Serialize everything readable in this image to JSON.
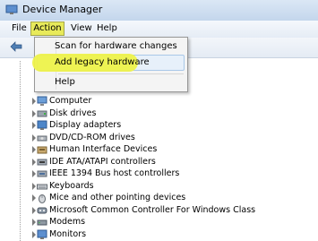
{
  "window": {
    "title": "Device Manager"
  },
  "menubar": {
    "file": "File",
    "action": "Action",
    "view": "View",
    "help": "Help"
  },
  "dropdown": {
    "items": [
      "Scan for hardware changes",
      "Add legacy hardware",
      "Help"
    ],
    "highlight_color": "#eef24a"
  },
  "tree": {
    "items": [
      {
        "label": "Computer",
        "icon": "computer-icon"
      },
      {
        "label": "Disk drives",
        "icon": "disk-icon"
      },
      {
        "label": "Display adapters",
        "icon": "display-icon"
      },
      {
        "label": "DVD/CD-ROM drives",
        "icon": "dvd-icon"
      },
      {
        "label": "Human Interface Devices",
        "icon": "hid-icon"
      },
      {
        "label": "IDE ATA/ATAPI controllers",
        "icon": "ide-icon"
      },
      {
        "label": "IEEE 1394 Bus host controllers",
        "icon": "ieee1394-icon"
      },
      {
        "label": "Keyboards",
        "icon": "keyboard-icon"
      },
      {
        "label": "Mice and other pointing devices",
        "icon": "mouse-icon"
      },
      {
        "label": "Microsoft Common Controller For Windows Class",
        "icon": "controller-icon"
      },
      {
        "label": "Modems",
        "icon": "modem-icon"
      },
      {
        "label": "Monitors",
        "icon": "monitor-icon"
      }
    ]
  }
}
